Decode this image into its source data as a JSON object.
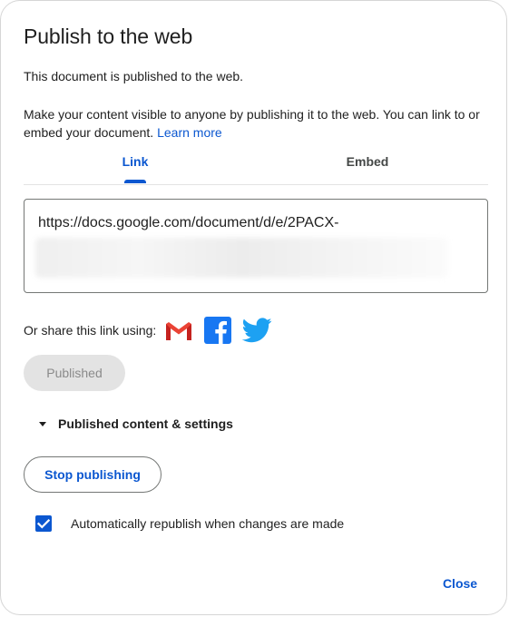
{
  "dialog": {
    "title": "Publish to the web",
    "status": "This document is published to the web.",
    "description": "Make your content visible to anyone by publishing it to the web. You can link to or embed your document.",
    "learn_more": "Learn more"
  },
  "tabs": [
    {
      "label": "Link",
      "selected": true
    },
    {
      "label": "Embed",
      "selected": false
    }
  ],
  "link": {
    "url_visible": "https://docs.google.com/document/d/e/2PACX-"
  },
  "share": {
    "label": "Or share this link using:",
    "services": [
      "gmail-icon",
      "facebook-icon",
      "twitter-icon"
    ]
  },
  "buttons": {
    "published": "Published",
    "stop_publishing": "Stop publishing",
    "close": "Close"
  },
  "expander": {
    "label": "Published content & settings",
    "expanded": false
  },
  "auto_republish": {
    "label": "Automatically republish when changes are made",
    "checked": true
  },
  "colors": {
    "accent": "#0b57d0",
    "gmail_red": "#ea4335",
    "facebook_blue": "#1877f2",
    "twitter_blue": "#1da1f2"
  }
}
